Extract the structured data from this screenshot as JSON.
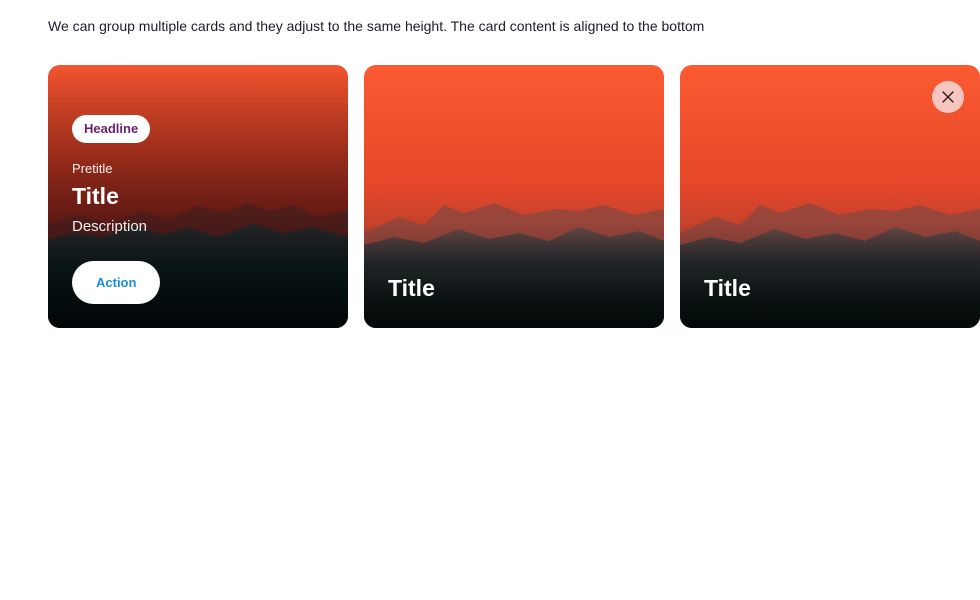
{
  "intro_text": "We can group multiple cards and they adjust to the same height. The card content is aligned to the bottom",
  "cards": [
    {
      "headline": "Headline",
      "pretitle": "Pretitle",
      "title": "Title",
      "description": "Description",
      "action_label": "Action"
    },
    {
      "title": "Title"
    },
    {
      "title": "Title",
      "close_icon": "close-icon"
    }
  ],
  "colors": {
    "sky_top": "#f5532f",
    "sky_dark": "#7a1d1d",
    "ground": "#021416",
    "headline_text": "#6b1f72",
    "action_text": "#1a8fd6",
    "close_bg": "#f7c5bf"
  }
}
